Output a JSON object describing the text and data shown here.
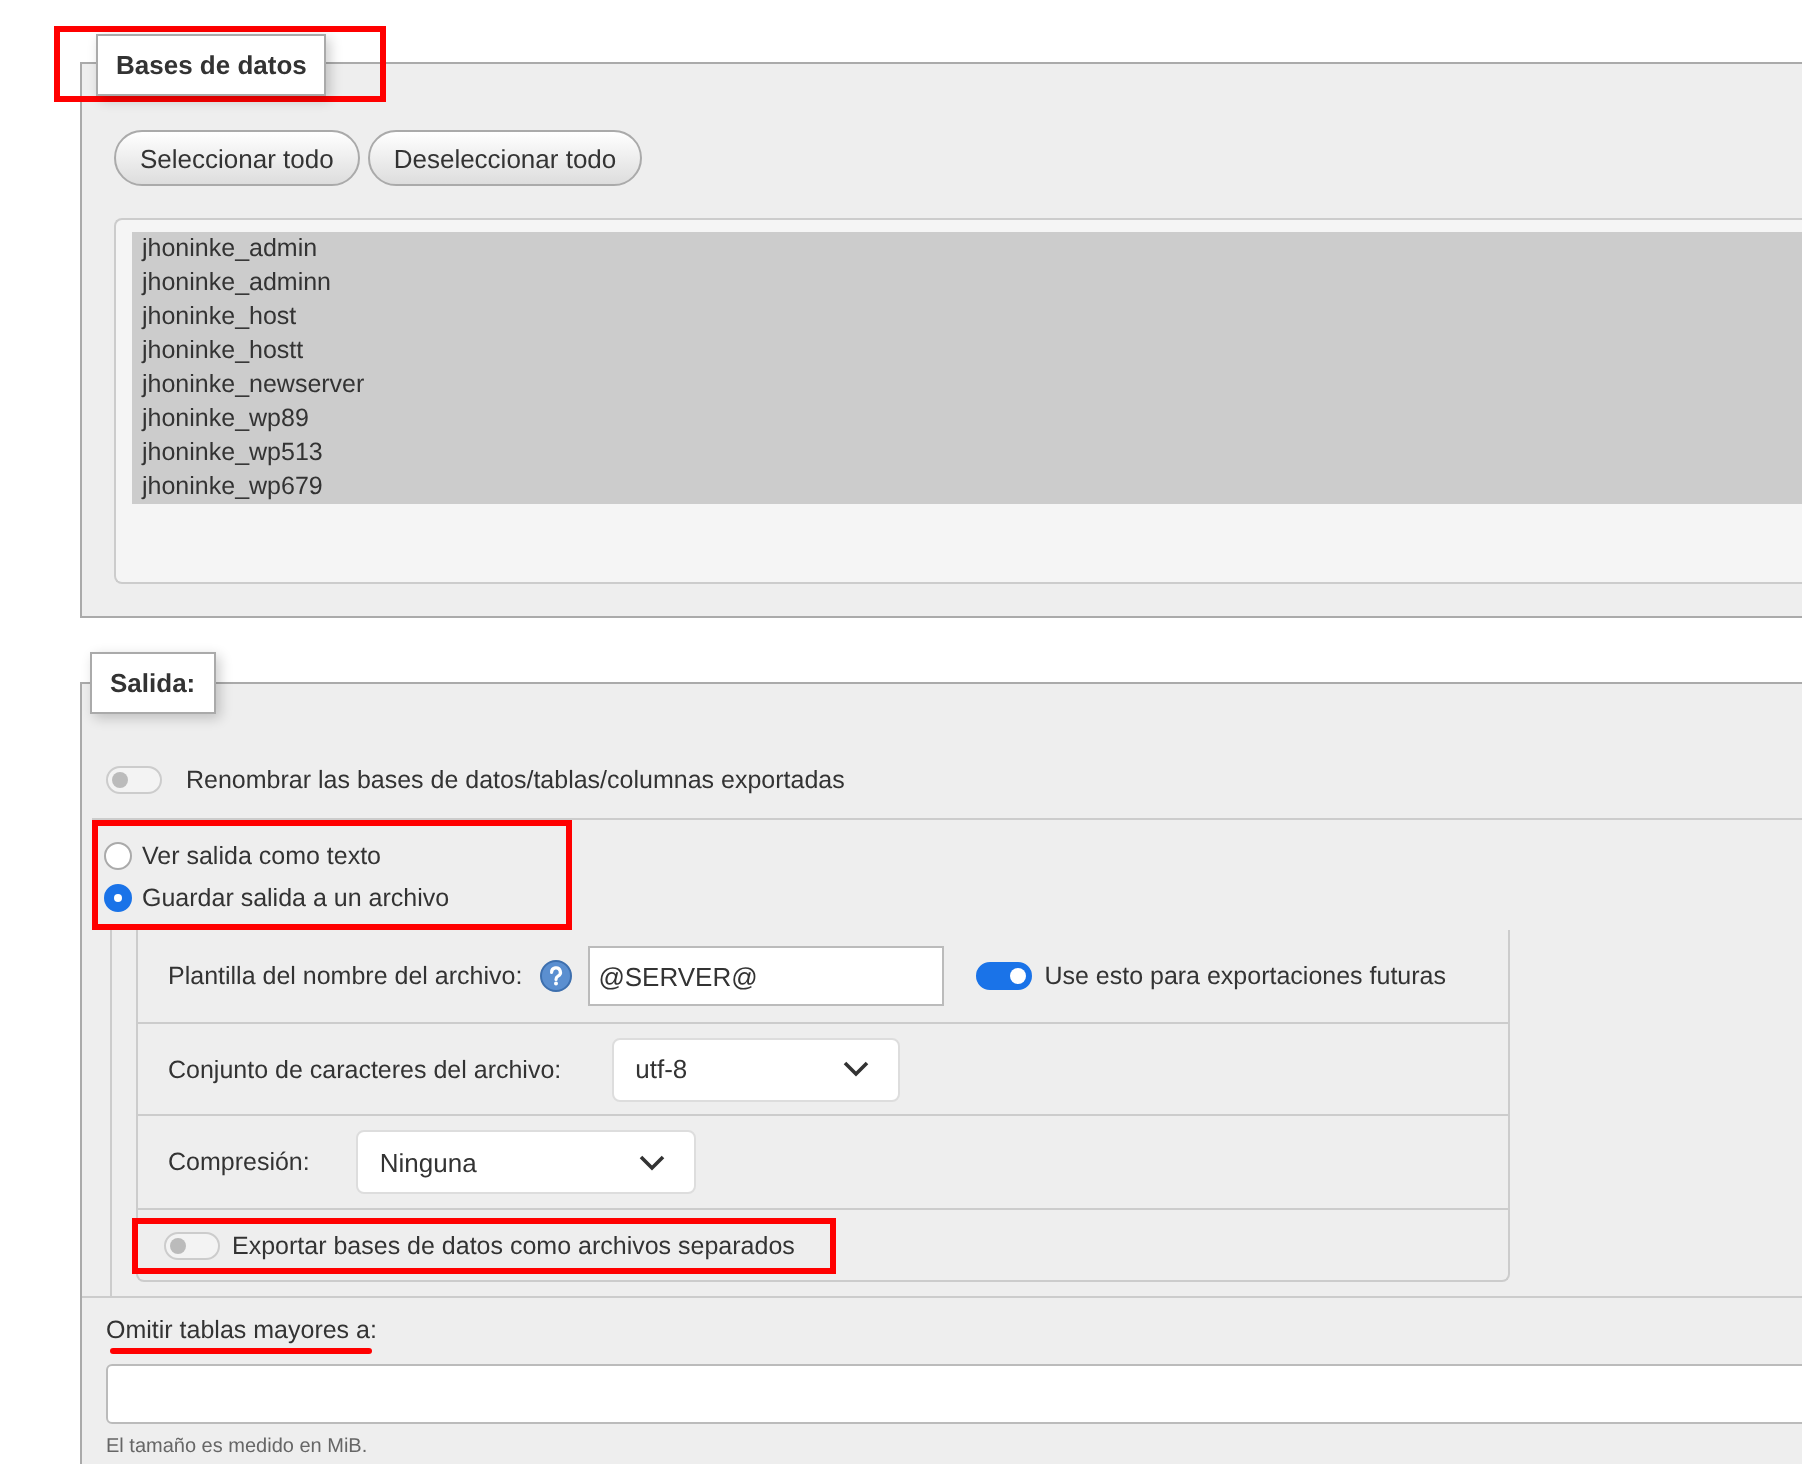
{
  "databases": {
    "legend": "Bases de datos",
    "highlighted": true,
    "buttons": [
      "Seleccionar todo",
      "Deseleccionar todo"
    ],
    "items": [
      {
        "label": "jhoninke_admin",
        "selected": true
      },
      {
        "label": "jhoninke_adminn",
        "selected": true
      },
      {
        "label": "jhoninke_host",
        "selected": true
      },
      {
        "label": "jhoninke_hostt",
        "selected": true
      },
      {
        "label": "jhoninke_newserver",
        "selected": true
      },
      {
        "label": "jhoninke_wp89",
        "selected": true
      },
      {
        "label": "jhoninke_wp513",
        "selected": true
      },
      {
        "label": "jhoninke_wp679",
        "selected": true
      }
    ]
  },
  "output": {
    "legend": "Salida:",
    "rename_toggle": {
      "label": "Renombrar las bases de datos/tablas/columnas exportadas",
      "on": false
    },
    "radios": {
      "highlighted": true,
      "options": [
        {
          "label": "Ver salida como texto",
          "selected": false
        },
        {
          "label": "Guardar salida a un archivo",
          "selected": true
        }
      ]
    },
    "file_options": {
      "template": {
        "label": "Plantilla del nombre del archivo:",
        "value": "@SERVER@",
        "remember": {
          "label": "Use esto para exportaciones futuras",
          "on": true
        }
      },
      "charset": {
        "label": "Conjunto de caracteres del archivo:",
        "value": "utf-8"
      },
      "compression": {
        "label": "Compresión:",
        "value": "Ninguna"
      },
      "separate": {
        "label": "Exportar bases de datos como archivos separados",
        "on": false,
        "highlighted": true
      }
    },
    "skip_tables": {
      "label": "Omitir tablas mayores a:",
      "underlined": true,
      "hint": "El tamaño es medido en MiB."
    }
  }
}
